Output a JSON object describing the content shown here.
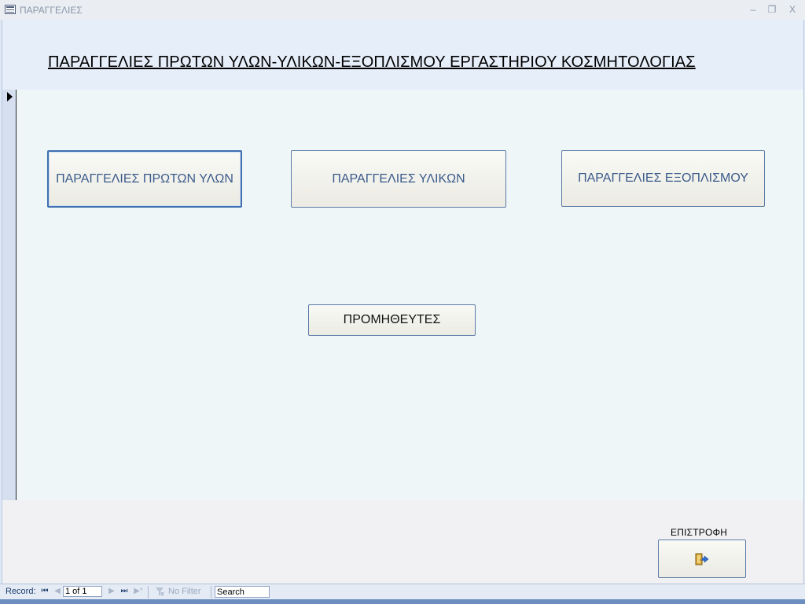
{
  "window": {
    "title": "ΠΑΡΑΓΓΕΛΙΕΣ",
    "minimize": "–",
    "restore": "❐",
    "close": "X"
  },
  "form": {
    "heading": "ΠΑΡΑΓΓΕΛΙΕΣ ΠΡΩΤΩΝ ΥΛΩΝ-ΥΛΙΚΩΝ-ΕΞΟΠΛΙΣΜΟΥ ΕΡΓΑΣΤΗΡΙΟΥ ΚΟΣΜΗΤΟΛΟΓΙΑΣ",
    "buttons": {
      "raw_materials": "ΠΑΡΑΓΓΕΛΙΕΣ ΠΡΩΤΩΝ ΥΛΩΝ",
      "materials": "ΠΑΡΑΓΓΕΛΙΕΣ ΥΛΙΚΩΝ",
      "equipment": "ΠΑΡΑΓΓΕΛΙΕΣ ΕΞΟΠΛΙΣΜΟΥ",
      "suppliers": "ΠΡΟΜΗΘΕΥΤΕΣ"
    },
    "return_label": "ΕΠΙΣΤΡΟΦΗ"
  },
  "navigation": {
    "record_label": "Record:",
    "record_value": "1 of 1",
    "first": "⏮",
    "prev": "◀",
    "next": "▶",
    "last": "⏭",
    "new": "▶*",
    "filter_label": "No Filter",
    "search_placeholder": "Search"
  },
  "colors": {
    "accent": "#3a5a8a",
    "background": "#eef6f8"
  }
}
